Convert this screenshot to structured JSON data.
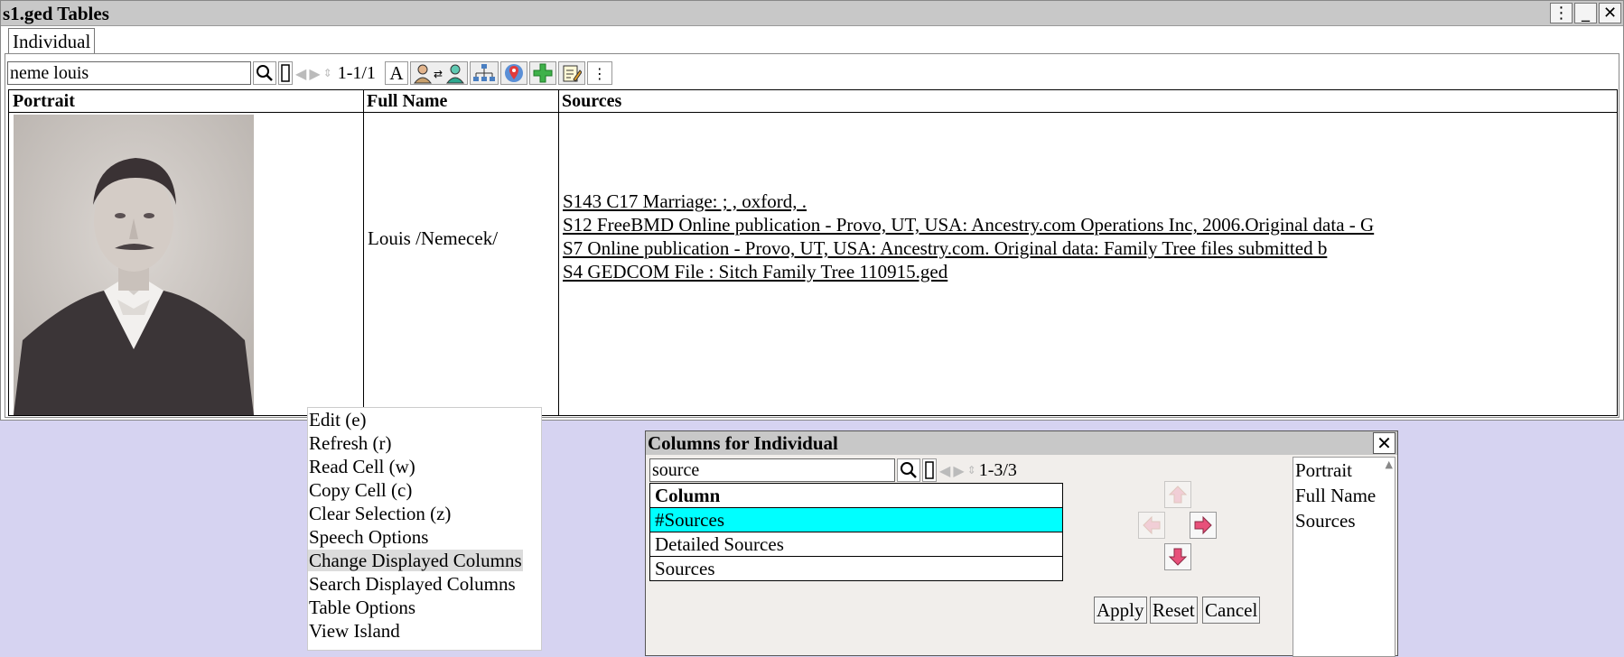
{
  "window": {
    "title": "s1.ged Tables",
    "buttons": {
      "menu": "⋮",
      "minimize": "_",
      "close": "✕"
    }
  },
  "tabs": [
    {
      "label": "Individual",
      "active": true
    }
  ],
  "toolbar": {
    "search_value": "neme louis",
    "count": "1-1/1",
    "font_button": "A",
    "icons": [
      "search-icon",
      "marker-icon",
      "prev-icon",
      "next-icon",
      "font-icon",
      "swap-person-icon",
      "tree-icon",
      "map-pin-icon",
      "add-icon",
      "edit-notes-icon",
      "more-icon"
    ]
  },
  "table": {
    "headers": [
      "Portrait",
      "Full Name",
      "Sources"
    ],
    "rows": [
      {
        "full_name": "Louis /Nemecek/",
        "sources": [
          "S143 C17 Marriage: ; , oxford, .",
          "S12 FreeBMD Online publication - Provo, UT, USA: Ancestry.com Operations Inc, 2006.Original data - G",
          "S7 Online publication - Provo, UT, USA: Ancestry.com. Original data: Family Tree files submitted b",
          "S4 GEDCOM File : Sitch Family Tree 110915.ged"
        ]
      }
    ]
  },
  "context_menu": {
    "items": [
      "Edit (e)",
      "Refresh (r)",
      "Read Cell (w)",
      "Copy Cell (c)",
      "Clear Selection (z)",
      "Speech Options",
      "Change Displayed Columns",
      "Search Displayed Columns",
      "Table Options",
      "View Island"
    ],
    "selected_index": 6
  },
  "columns_dialog": {
    "title": "Columns for Individual",
    "search_value": "source",
    "count": "1-3/3",
    "list_header": "Column",
    "available": [
      "#Sources",
      "Detailed Sources",
      "Sources"
    ],
    "highlighted_index": 0,
    "displayed": [
      "Portrait",
      "Full Name",
      "Sources"
    ],
    "buttons": {
      "apply": "Apply",
      "reset": "Reset",
      "cancel": "Cancel"
    },
    "colors": {
      "highlight": "#00ffff",
      "arrow": "#e8507a"
    }
  }
}
